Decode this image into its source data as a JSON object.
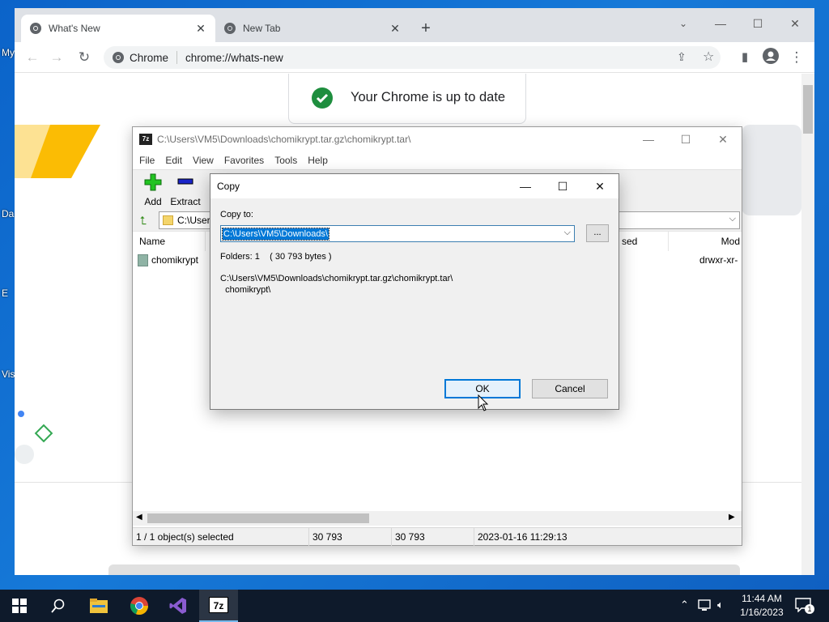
{
  "desktop": {
    "icon_labels": [
      "My",
      "Da",
      "E",
      "Vis"
    ]
  },
  "chrome": {
    "tabs": [
      {
        "label": "What's New",
        "active": true
      },
      {
        "label": "New Tab",
        "active": false
      }
    ],
    "new_tab_label": "+",
    "omnibox": {
      "site_chip": "Chrome",
      "url": "chrome://whats-new"
    },
    "page": {
      "update_status": "Your Chrome is up to date"
    }
  },
  "sevenzip": {
    "title": "C:\\Users\\VM5\\Downloads\\chomikrypt.tar.gz\\chomikrypt.tar\\",
    "app_icon_text": "7z",
    "menu": [
      "File",
      "Edit",
      "View",
      "Favorites",
      "Tools",
      "Help"
    ],
    "toolbar": [
      {
        "label": "Add",
        "icon": "add-icon"
      },
      {
        "label": "Extract",
        "icon": "extract-icon"
      }
    ],
    "path_value": "C:\\User",
    "columns": {
      "name": "Name",
      "partial_col": "sed",
      "mode": "Mod"
    },
    "rows": [
      {
        "name": "chomikrypt",
        "mode": "drwxr-xr-"
      }
    ],
    "status": {
      "selected": "1 / 1 object(s) selected",
      "size": "30 793",
      "packed": "30 793",
      "modified": "2023-01-16 11:29:13"
    }
  },
  "copy_dialog": {
    "title": "Copy",
    "copy_to_label": "Copy to:",
    "destination": "C:\\Users\\VM5\\Downloads\\",
    "browse_label": "...",
    "folders_info": "Folders: 1    ( 30 793 bytes )",
    "source_line1": "C:\\Users\\VM5\\Downloads\\chomikrypt.tar.gz\\chomikrypt.tar\\",
    "source_line2": "  chomikrypt\\",
    "ok_label": "OK",
    "cancel_label": "Cancel"
  },
  "taskbar": {
    "time": "11:44 AM",
    "date": "1/16/2023",
    "notification_count": "1",
    "pinned": [
      "start-icon",
      "search-icon",
      "file-explorer-icon",
      "chrome-icon",
      "visual-studio-icon",
      "7zip-icon"
    ]
  },
  "colors": {
    "accent": "#0078d7",
    "chrome_tabstrip": "#dee1e6",
    "success_green": "#1e8e3e",
    "taskbar": "#0e1a2b"
  }
}
